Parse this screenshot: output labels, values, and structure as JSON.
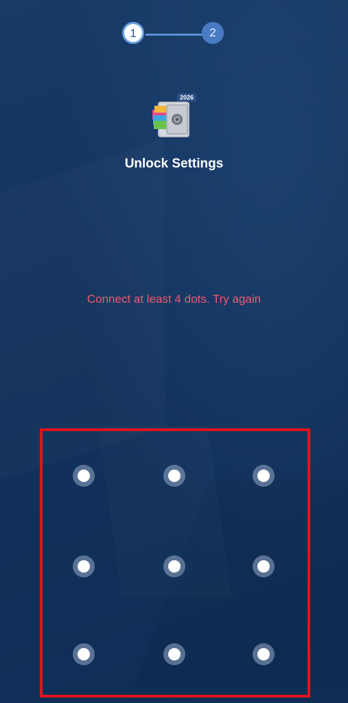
{
  "stepper": {
    "step1": "1",
    "step2": "2",
    "current_step": 1
  },
  "app": {
    "icon_name": "applock-vault-icon",
    "icon_badge": "2026"
  },
  "screen": {
    "title": "Unlock Settings",
    "error_message": "Connect at least 4 dots. Try again"
  },
  "pattern": {
    "rows": 3,
    "cols": 3
  },
  "colors": {
    "background": "#12325c",
    "error": "#ef5a6f",
    "highlight_frame": "#e1141b",
    "step_active": "#ffffff",
    "step_inactive": "#4a7cc4"
  }
}
